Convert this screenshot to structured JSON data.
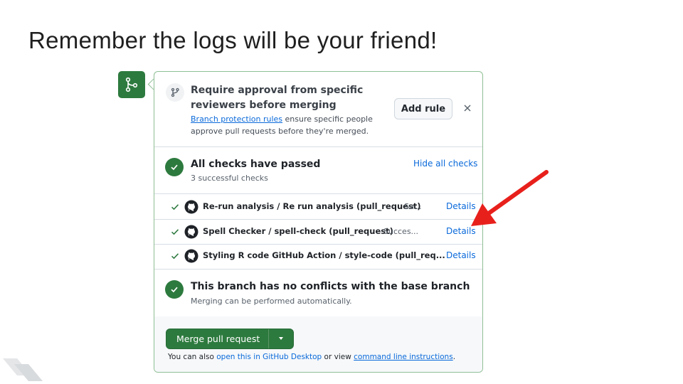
{
  "slide": {
    "title": "Remember the logs will be your friend!"
  },
  "colors": {
    "green": "#2d7a3e",
    "link": "#0969da",
    "arrow": "#e8201c"
  },
  "protection": {
    "title": "Require approval from specific reviewers before merging",
    "desc_link": "Branch protection rules",
    "desc_rest": " ensure specific people approve pull requests before they're merged.",
    "add_rule_label": "Add rule"
  },
  "checks": {
    "title": "All checks have passed",
    "subtitle": "3 successful checks",
    "hide_label": "Hide all checks",
    "items": [
      {
        "name": "Re-run analysis / Re run analysis (pull_request)",
        "status": "Su...",
        "details": "Details"
      },
      {
        "name": "Spell Checker / spell-check (pull_request)",
        "status": "Succes...",
        "details": "Details"
      },
      {
        "name": "Styling R code GitHub Action / style-code (pull_req...",
        "status": "",
        "details": "Details"
      }
    ]
  },
  "conflicts": {
    "title": "This branch has no conflicts with the base branch",
    "subtitle": "Merging can be performed automatically."
  },
  "merge": {
    "button_label": "Merge pull request",
    "note_prefix": "You can also ",
    "note_link1": "open this in GitHub Desktop",
    "note_mid": " or view ",
    "note_link2": "command line instructions",
    "note_suffix": "."
  }
}
